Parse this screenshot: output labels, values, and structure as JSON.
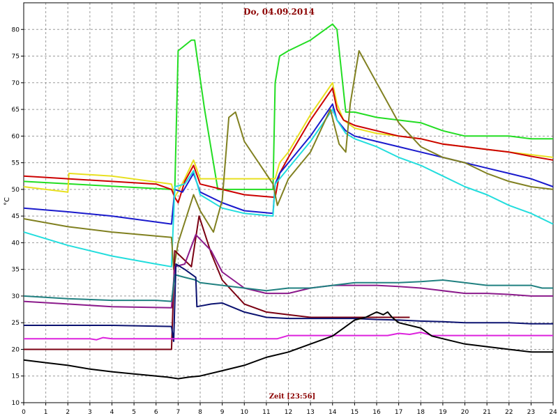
{
  "chart_data": {
    "type": "line",
    "title": "Do, 04.09.2014",
    "xlabel": "Zeit [23:56]",
    "ylabel": "°C",
    "xlim": [
      0,
      24
    ],
    "ylim": [
      10,
      85
    ],
    "xticks": [
      "0",
      "1",
      "2",
      "3",
      "4",
      "5",
      "6",
      "7",
      "8",
      "9",
      "10",
      "11",
      "12",
      "13",
      "14",
      "15",
      "16",
      "17",
      "18",
      "19",
      "20",
      "21",
      "22",
      "23",
      "24"
    ],
    "yticks": [
      "10",
      "15",
      "20",
      "25",
      "30",
      "35",
      "40",
      "45",
      "50",
      "55",
      "60",
      "65",
      "70",
      "75",
      "80"
    ],
    "grid": true,
    "series": [
      {
        "color": "#22dd22",
        "x": [
          0,
          6.7,
          6.85,
          7.0,
          7.6,
          7.75,
          8.2,
          8.8,
          9.2,
          10,
          11.3,
          11.4,
          11.6,
          12,
          13,
          14,
          14.2,
          14.6,
          15,
          16,
          17,
          18,
          19,
          20,
          21,
          22,
          23,
          24
        ],
        "y": [
          51.5,
          50,
          50,
          76,
          78,
          78,
          65,
          50,
          50,
          50,
          50,
          70,
          75,
          76,
          78,
          81,
          80,
          64.5,
          64.5,
          63.5,
          63,
          62.5,
          61,
          60,
          60,
          60,
          59.5,
          59.5
        ]
      },
      {
        "color": "#e8e020",
        "x": [
          0,
          2,
          2.05,
          4,
          6.7,
          6.85,
          7.3,
          7.7,
          8,
          9,
          10,
          11.4,
          11.6,
          12,
          13,
          14,
          14.2,
          14.5,
          15,
          16,
          17,
          18,
          19,
          20,
          21,
          22,
          23,
          24
        ],
        "y": [
          50.5,
          49.5,
          53,
          52.5,
          51,
          48.5,
          52,
          55.5,
          52,
          52,
          52,
          52,
          55,
          57,
          64,
          70,
          66,
          63,
          61.5,
          60.5,
          60,
          59.5,
          58.5,
          58,
          57.5,
          57,
          56.5,
          56
        ]
      },
      {
        "color": "#cc0000",
        "x": [
          0,
          2,
          4,
          6,
          6.7,
          6.85,
          7.0,
          7.3,
          7.7,
          8,
          9,
          10,
          11.4,
          11.6,
          12,
          13,
          14,
          14.2,
          14.5,
          15,
          16,
          17,
          18,
          19,
          20,
          21,
          22,
          23,
          24
        ],
        "y": [
          52.5,
          52,
          51.5,
          51,
          50,
          48.5,
          47.5,
          51.5,
          54.5,
          51,
          50,
          49,
          48.5,
          53,
          56,
          63,
          69,
          65,
          63,
          62,
          61,
          60,
          59.5,
          58.5,
          58,
          57.5,
          57,
          56.2,
          55.5
        ]
      },
      {
        "color": "#1a1acc",
        "x": [
          0,
          2,
          4,
          6.7,
          6.85,
          7.2,
          7.7,
          8,
          9,
          10,
          11.3,
          11.4,
          11.6,
          12,
          13,
          14,
          14.2,
          14.6,
          15,
          16,
          17,
          18,
          19,
          20,
          21,
          22,
          23,
          24
        ],
        "y": [
          46.5,
          45.8,
          45,
          43.5,
          50,
          49.5,
          53,
          49.5,
          47.5,
          46,
          45.5,
          51,
          53,
          55,
          60,
          66,
          63,
          61,
          60,
          59,
          58,
          57,
          56,
          55,
          54,
          53,
          52,
          50.5
        ]
      },
      {
        "color": "#22dddd",
        "x": [
          0,
          2,
          4,
          6,
          6.7,
          6.85,
          7.3,
          7.7,
          8,
          9,
          10,
          11.3,
          11.4,
          11.6,
          12,
          13,
          14,
          14.2,
          14.6,
          15,
          16,
          17,
          18,
          19,
          20,
          21,
          22,
          23,
          24
        ],
        "y": [
          42,
          39.5,
          37.5,
          36,
          35.5,
          50.5,
          51,
          53.5,
          49,
          46.5,
          45.5,
          45,
          51,
          52,
          54,
          59,
          65,
          63,
          60.5,
          59.5,
          58,
          56,
          54.5,
          52.5,
          50.5,
          49,
          47,
          45.5,
          43.5
        ]
      },
      {
        "color": "#808020",
        "x": [
          0,
          2,
          4,
          6.7,
          6.8,
          7.0,
          7.7,
          8,
          8.6,
          9.0,
          9.3,
          9.6,
          10,
          11.3,
          11.5,
          12,
          13,
          13.9,
          14.3,
          14.6,
          14.8,
          15.2,
          16,
          17,
          18,
          19,
          20,
          21,
          22,
          23,
          24
        ],
        "y": [
          44.5,
          43,
          42,
          41,
          35,
          40,
          49,
          46,
          42,
          48,
          63.5,
          64.5,
          59,
          51,
          47,
          52,
          57,
          65,
          58.5,
          57,
          66,
          76,
          70,
          62.5,
          58,
          56,
          55,
          53,
          51.5,
          50.5,
          50
        ]
      },
      {
        "color": "#7a0012",
        "x": [
          0,
          6.7,
          6.85,
          7.6,
          7.95,
          8.5,
          9,
          10,
          11,
          12,
          13,
          14,
          15,
          16,
          17,
          17.5
        ],
        "y": [
          20,
          20,
          38.5,
          35.5,
          45,
          38,
          33,
          28.5,
          27,
          26.5,
          26,
          26,
          26,
          26,
          26,
          26
        ]
      },
      {
        "color": "#8b1a8b",
        "x": [
          0,
          2,
          4,
          6.7,
          6.85,
          7.3,
          7.8,
          8.5,
          9,
          10,
          11,
          12,
          13,
          14,
          15,
          16,
          17,
          18,
          19,
          20,
          21,
          22,
          23,
          24
        ],
        "y": [
          29,
          28.5,
          28,
          27.8,
          35.5,
          36,
          41.5,
          38.5,
          34.5,
          31.5,
          30.5,
          30.5,
          31.5,
          32,
          32,
          32,
          31.8,
          31.5,
          31,
          30.5,
          30.5,
          30.3,
          30,
          30
        ]
      },
      {
        "color": "#208080",
        "x": [
          0,
          2,
          4,
          6,
          6.7,
          6.85,
          7.3,
          7.8,
          8,
          9,
          10,
          11,
          12,
          13,
          14,
          15,
          16,
          17,
          18,
          19,
          20,
          21,
          22,
          23,
          23.5,
          24
        ],
        "y": [
          30,
          29.5,
          29.2,
          29.2,
          29,
          34,
          33.5,
          33,
          32.5,
          32,
          31.5,
          31,
          31.5,
          31.5,
          32,
          32.5,
          32.5,
          32.5,
          32.7,
          33,
          32.5,
          32,
          32,
          32,
          31.5,
          31.5
        ]
      },
      {
        "color": "#0b1270",
        "x": [
          0,
          2,
          4,
          6.7,
          6.8,
          6.9,
          7.3,
          7.8,
          7.85,
          8.5,
          9,
          10,
          11,
          12,
          13,
          14,
          15,
          16,
          17,
          18,
          19,
          20,
          21,
          22,
          23,
          24
        ],
        "y": [
          24.5,
          24.5,
          24.5,
          24.3,
          21.5,
          36,
          35,
          33.5,
          28,
          28.5,
          28.7,
          27,
          26,
          25.8,
          25.8,
          25.8,
          25.8,
          25.6,
          25.5,
          25.3,
          25.2,
          25,
          25,
          25,
          24.8,
          24.8
        ]
      },
      {
        "color": "#dd22dd",
        "x": [
          0,
          3,
          3.3,
          3.6,
          4,
          5,
          6.5,
          7,
          8,
          9,
          10,
          11,
          11.5,
          12,
          13,
          14,
          15,
          16,
          16.5,
          17,
          17.5,
          18,
          18.5,
          19,
          20,
          21,
          22,
          23,
          24
        ],
        "y": [
          22,
          22,
          21.8,
          22.2,
          22,
          22,
          22,
          22,
          22,
          22,
          22,
          22,
          22,
          22.6,
          22.6,
          22.6,
          22.6,
          22.6,
          22.6,
          23,
          22.8,
          23.2,
          22.6,
          22.6,
          22.6,
          22.6,
          22.6,
          22.6,
          22.6
        ]
      },
      {
        "color": "#000000",
        "x": [
          0,
          1,
          2,
          3,
          4,
          5,
          6,
          6.5,
          7,
          7.5,
          8,
          9,
          10,
          11,
          12,
          13,
          14,
          14.5,
          15,
          15.5,
          16,
          16.3,
          16.5,
          16.7,
          17,
          18,
          18.5,
          19,
          20,
          21,
          22,
          23,
          24
        ],
        "y": [
          18,
          17.5,
          17,
          16.3,
          15.8,
          15.4,
          15,
          14.8,
          14.5,
          14.8,
          15,
          16,
          17,
          18.5,
          19.5,
          21,
          22.5,
          24,
          25.5,
          26,
          27,
          26.5,
          27,
          26,
          25,
          24,
          22.5,
          22,
          21,
          20.5,
          20,
          19.5,
          19.5
        ]
      }
    ]
  }
}
